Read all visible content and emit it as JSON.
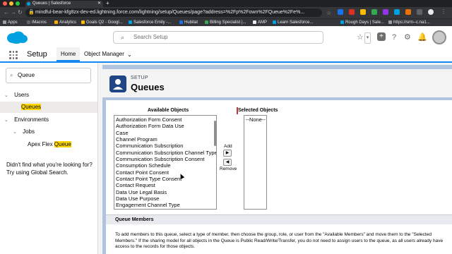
{
  "browser": {
    "tab_title": "Queues | Salesforce",
    "url": "mindful-bear-kfg8zx-dev-ed.lightning.force.com/lightning/setup/Queues/page?address=%2Fp%2Fown%2FQueue%2Fe%...",
    "bookmarks": [
      "Apps",
      "iMacros",
      "Analytics",
      "Goals Q2 - Googl...",
      "Salesforce Emily -...",
      "Hubitat",
      "Billing Specialist |...",
      "AMP",
      "Learn Salesforce...",
      "Rough Days | Sale...",
      "https://srm--c.na1..."
    ]
  },
  "header": {
    "search_placeholder": "Search Setup"
  },
  "nav": {
    "app_name": "Setup",
    "tabs": [
      "Home",
      "Object Manager"
    ]
  },
  "sidebar": {
    "quick_find_value": "Queue",
    "tree": {
      "users": "Users",
      "queues": "Queues",
      "environments": "Environments",
      "jobs": "Jobs",
      "apex_prefix": "Apex Flex ",
      "apex_highlight": "Queue"
    },
    "not_found_text": "Didn't find what you're looking for? Try using Global Search."
  },
  "page": {
    "breadcrumb": "SETUP",
    "title": "Queues"
  },
  "objects": {
    "available_header": "Available Objects",
    "selected_header": "Selected Objects",
    "available": [
      "Authorization Form Consent",
      "Authorization Form Data Use",
      "Case",
      "Channel Program",
      "Communication Subscription",
      "Communication Subscription Channel Type",
      "Communication Subscription Consent",
      "Consumption Schedule",
      "Contact Point Consent",
      "Contact Point Type Consent",
      "Contact Request",
      "Data Use Legal Basis",
      "Data Use Purpose",
      "Engagement Channel Type"
    ],
    "selected": [
      "--None--"
    ],
    "add_label": "Add",
    "remove_label": "Remove",
    "add_arrow": "▶",
    "remove_arrow": "◀"
  },
  "members": {
    "section_title": "Queue Members",
    "description": "To add members to this queue, select a type of member, then choose the group, role, or user from the \"Available Members\" and move them to the \"Selected Members.\" If the sharing model for all objects in the Queue is Public Read/Write/Transfer, you do not need to assign users to the queue, as all users already have access to the records for those objects."
  }
}
